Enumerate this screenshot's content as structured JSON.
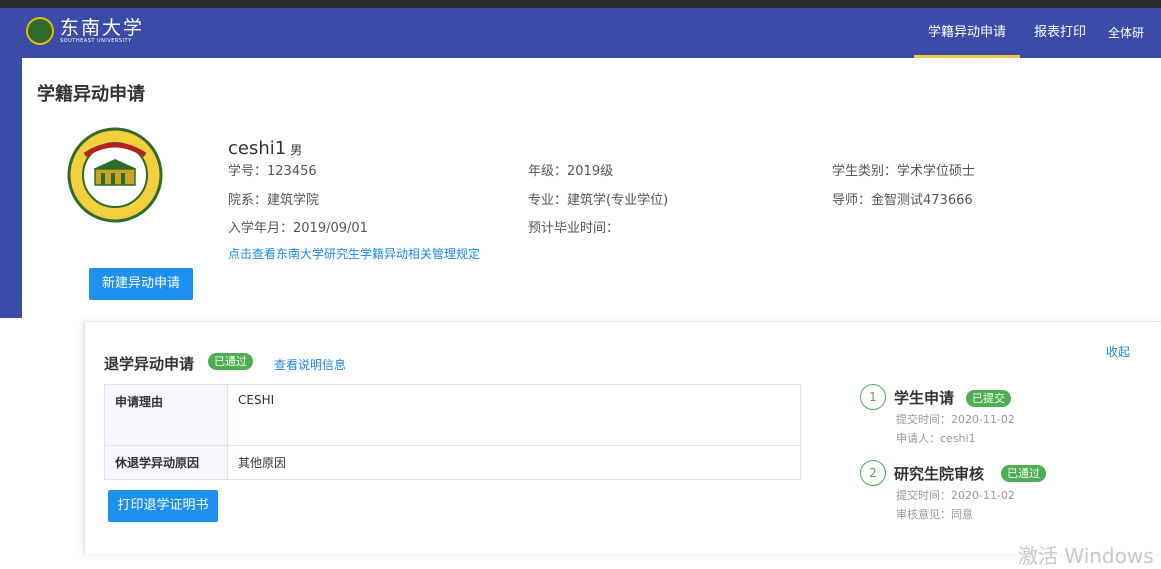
{
  "header": {
    "logo_cn": "东南大学",
    "logo_en": "SOUTHEAST UNIVERSITY",
    "nav": [
      "学籍异动申请",
      "报表打印",
      "全体研"
    ]
  },
  "page": {
    "title": "学籍异动申请"
  },
  "student": {
    "name": "ceshi1",
    "gender": "男",
    "id": "学号：123456",
    "grade": "年级：2019级",
    "type": "学生类别：学术学位硕士",
    "dept": "院系：建筑学院",
    "major": "专业：建筑学(专业学位)",
    "advisor": "导师：金智测试473666",
    "enroll": "入学年月：2019/09/01",
    "grad": "预计毕业时间：",
    "rule_link": "点击查看东南大学研究生学籍异动相关管理规定"
  },
  "actions": {
    "new_label": "新建异动申请",
    "print_label": "打印退学证明书"
  },
  "application": {
    "title": "退学异动申请",
    "status": "已通过",
    "desc_link": "查看说明信息",
    "collapse": "收起",
    "rows": [
      {
        "label": "申请理由",
        "value": "CESHI"
      },
      {
        "label": "休退学异动原因",
        "value": "其他原因"
      }
    ]
  },
  "steps": [
    {
      "num": "1",
      "title": "学生申请",
      "badge": "已提交",
      "line1": "提交时间：2020-11-02",
      "line2": "申请人：ceshi1"
    },
    {
      "num": "2",
      "title": "研究生院审核",
      "badge": "已通过",
      "line1": "提交时间：2020-11-02",
      "line2": "审核意见：同意"
    }
  ],
  "watermark": "激活 Windows",
  "colors": {
    "header": "#3b4ba8",
    "accent": "#f5c242",
    "primary_button": "#1e90f0",
    "success": "#4caf50",
    "link": "#1e88e5"
  }
}
